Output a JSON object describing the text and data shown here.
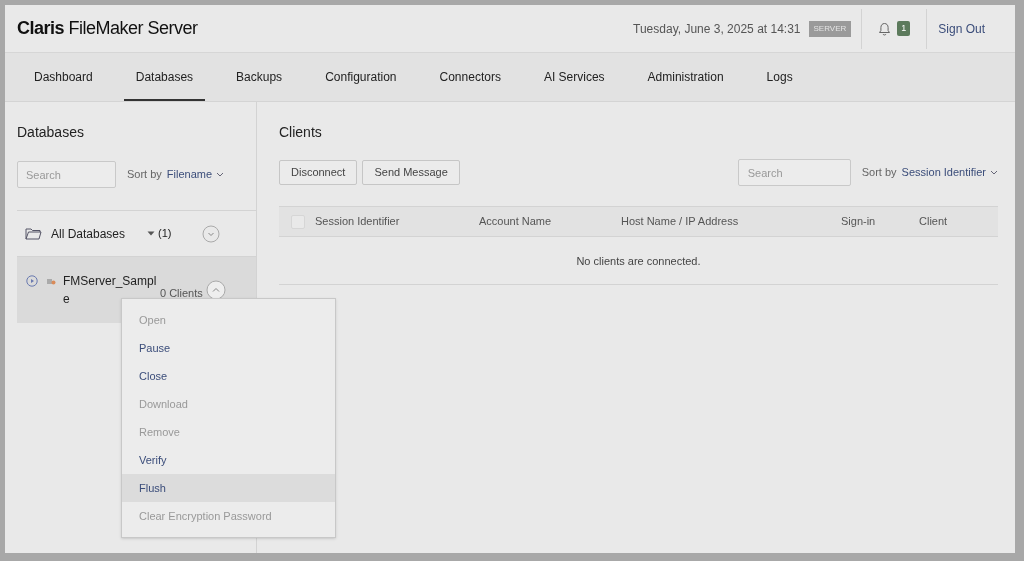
{
  "header": {
    "brand_bold": "Claris",
    "brand_rest": "FileMaker Server",
    "datetime": "Tuesday, June 3, 2025 at 14:31",
    "server_badge": "SERVER",
    "notification_count": "1",
    "sign_out": "Sign Out"
  },
  "tabs": [
    {
      "label": "Dashboard",
      "selected": false
    },
    {
      "label": "Databases",
      "selected": true
    },
    {
      "label": "Backups",
      "selected": false
    },
    {
      "label": "Configuration",
      "selected": false
    },
    {
      "label": "Connectors",
      "selected": false
    },
    {
      "label": "AI Services",
      "selected": false
    },
    {
      "label": "Administration",
      "selected": false
    },
    {
      "label": "Logs",
      "selected": false
    }
  ],
  "databases": {
    "title": "Databases",
    "search": {
      "placeholder": "Search"
    },
    "sort_label": "Sort by",
    "sort_value": "Filename",
    "group": {
      "label": "All Databases",
      "count": "(1)"
    },
    "items": [
      {
        "name": "FMServer_Sample",
        "clients": "0 Clients",
        "selected": true
      }
    ]
  },
  "menu": [
    {
      "label": "Open",
      "disabled": true,
      "selected": false
    },
    {
      "label": "Pause",
      "disabled": false,
      "selected": false
    },
    {
      "label": "Close",
      "disabled": false,
      "selected": false
    },
    {
      "label": "Download",
      "disabled": true,
      "selected": false
    },
    {
      "label": "Remove",
      "disabled": true,
      "selected": false
    },
    {
      "label": "Verify",
      "disabled": false,
      "selected": false
    },
    {
      "label": "Flush",
      "disabled": false,
      "selected": true
    },
    {
      "label": "Clear Encryption Password",
      "disabled": true,
      "selected": false
    }
  ],
  "clients": {
    "title": "Clients",
    "buttons": [
      "Disconnect",
      "Send Message"
    ],
    "search": {
      "placeholder": "Search"
    },
    "sort_label": "Sort by",
    "sort_value": "Session Identifier",
    "select_all": {
      "checked": false
    },
    "columns": [
      "Session Identifier",
      "Account Name",
      "Host Name / IP Address",
      "Sign-in",
      "Client"
    ],
    "empty_message": "No clients are connected."
  }
}
